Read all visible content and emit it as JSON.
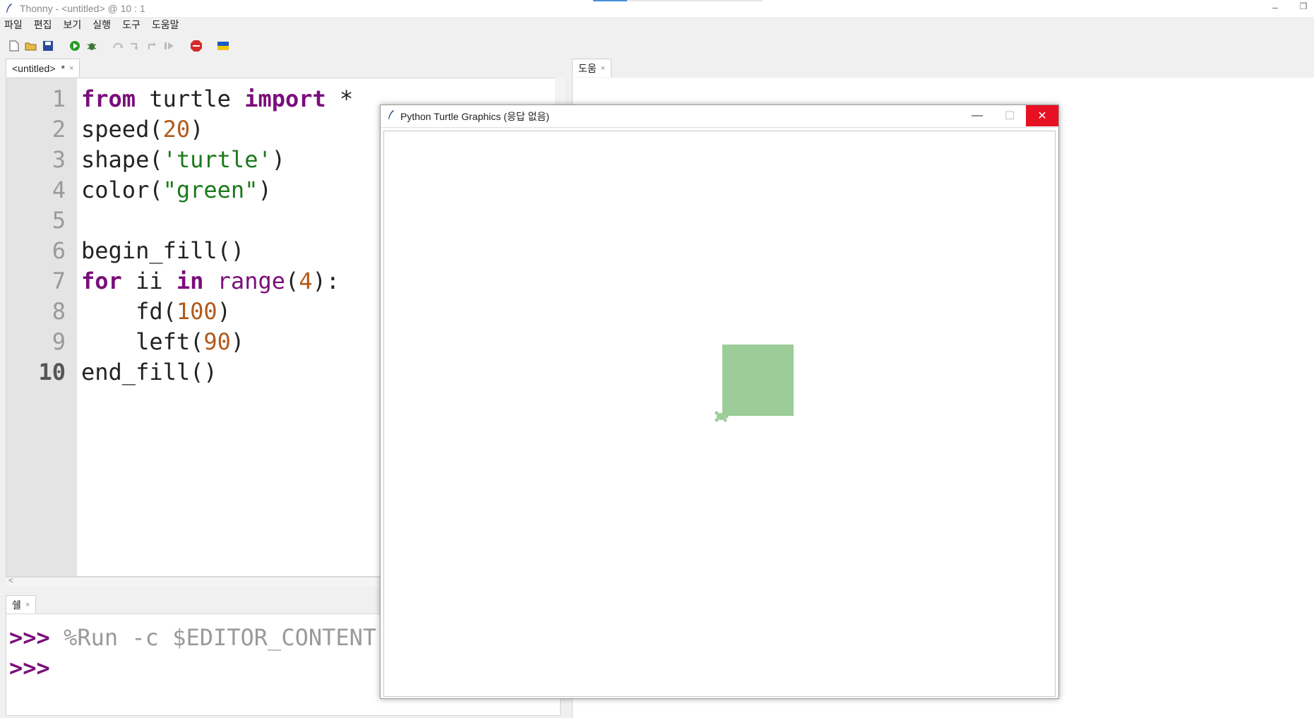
{
  "titlebar": {
    "title": "Thonny  -  <untitled>  @  10 : 1",
    "minimize": "–",
    "restore": "❐"
  },
  "menu": [
    "파일",
    "편집",
    "보기",
    "실행",
    "도구",
    "도움말"
  ],
  "editor": {
    "tab_label": "<untitled>",
    "tab_modified": "*",
    "tab_close": "×",
    "current_line": 10,
    "lines": [
      {
        "no": "1"
      },
      {
        "no": "2"
      },
      {
        "no": "3"
      },
      {
        "no": "4"
      },
      {
        "no": "5"
      },
      {
        "no": "6"
      },
      {
        "no": "7"
      },
      {
        "no": "8"
      },
      {
        "no": "9"
      },
      {
        "no": "10"
      }
    ],
    "code": {
      "l1_kw1": "from",
      "l1_mod": " turtle ",
      "l1_kw2": "import",
      "l1_rest": " *",
      "l2_fn": "speed(",
      "l2_num": "20",
      "l2_end": ")",
      "l3_fn": "shape(",
      "l3_str": "'turtle'",
      "l3_end": ")",
      "l4_fn": "color(",
      "l4_str": "\"green\"",
      "l4_end": ")",
      "l6": "begin_fill()",
      "l7_kw1": "for",
      "l7_var": " ii ",
      "l7_kw2": "in",
      "l7_sp": " ",
      "l7_builtin": "range",
      "l7_open": "(",
      "l7_num": "4",
      "l7_end": "):",
      "l8_fn": "    fd(",
      "l8_num": "100",
      "l8_end": ")",
      "l9_fn": "    left(",
      "l9_num": "90",
      "l9_end": ")",
      "l10": "end_fill()"
    },
    "hscroll_arrow": "<"
  },
  "help": {
    "tab_label": "도움",
    "tab_close": "×"
  },
  "shell": {
    "tab_label": "쉘",
    "tab_close": "×",
    "prompt": ">>>",
    "command": " %Run -c $EDITOR_CONTENT"
  },
  "turtle_window": {
    "title": "Python Turtle Graphics (응답 없음)",
    "minimize": "—",
    "maximize": "☐",
    "close": "✕",
    "fill_color": "#9ccc98"
  },
  "colors": {
    "keyword": "#7a0e7a",
    "number": "#b15a1a",
    "string": "#1a7a1a",
    "close_button": "#e81123"
  }
}
